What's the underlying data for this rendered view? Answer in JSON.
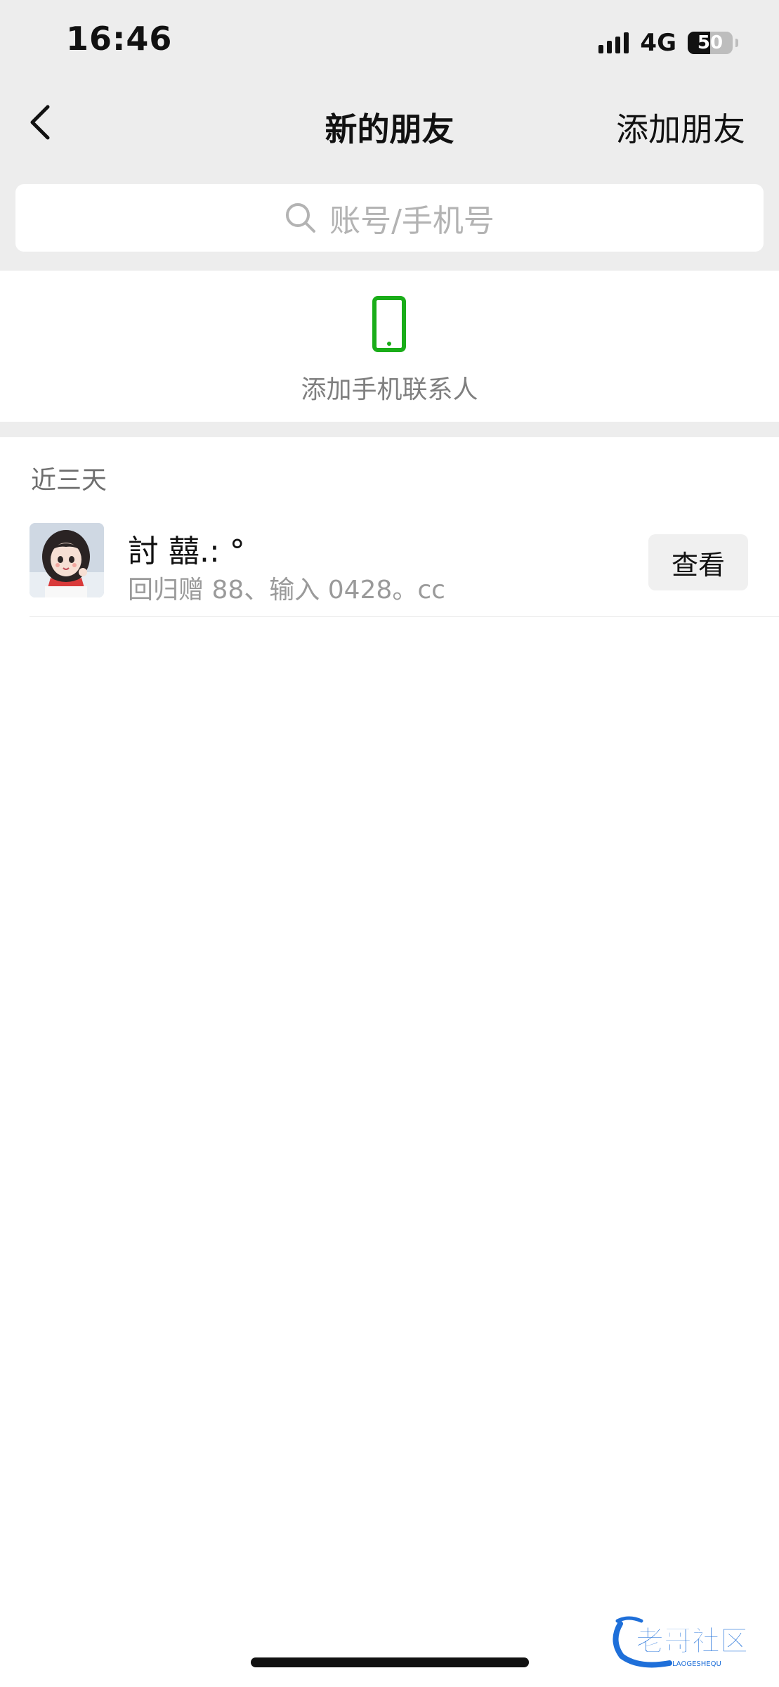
{
  "status_bar": {
    "time": "16:46",
    "network": "4G",
    "battery_level": "50",
    "battery_fraction": 0.5,
    "signal_bars": 4
  },
  "nav": {
    "title": "新的朋友",
    "action_label": "添加朋友",
    "back_icon": "chevron-left-icon"
  },
  "search": {
    "placeholder": "账号/手机号",
    "icon": "search-icon"
  },
  "add_contacts": {
    "label": "添加手机联系人",
    "icon": "phone-icon",
    "icon_color": "#1aad19"
  },
  "recent": {
    "section_title": "近三天",
    "requests": [
      {
        "name": "討 囍.: °",
        "message": "回归赠 88、输入 0428。cc",
        "button_label": "查看"
      }
    ]
  },
  "watermark": {
    "text": "老哥社区",
    "subtext": "LAOGESHEQU"
  },
  "colors": {
    "background_top": "#ededed",
    "accent_green": "#1aad19",
    "watermark_blue": "#1e6fd9"
  }
}
